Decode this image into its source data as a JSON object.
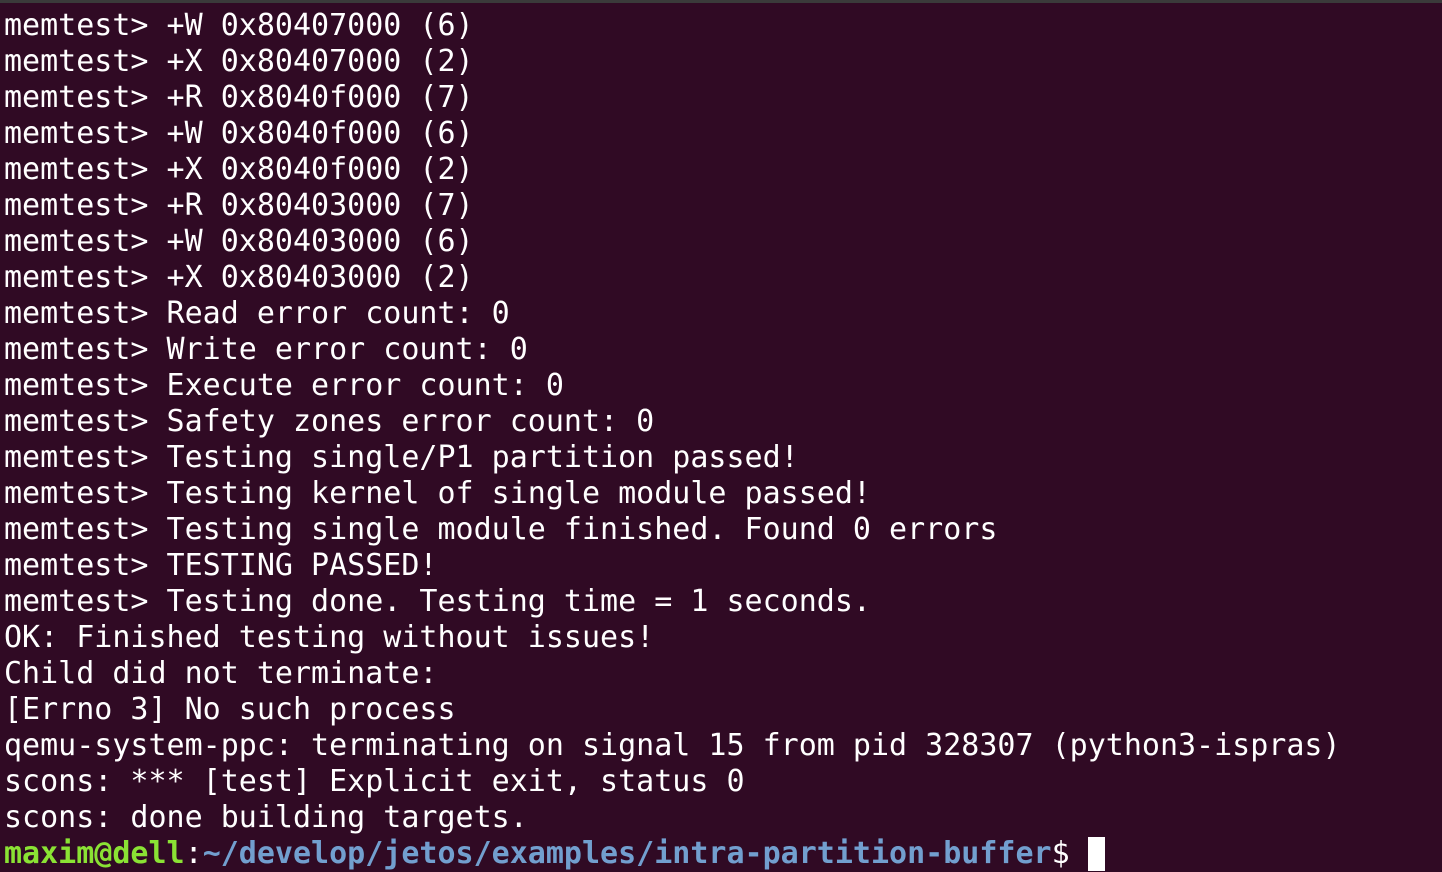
{
  "terminal": {
    "lines": [
      "memtest> +W 0x80407000 (6)",
      "memtest> +X 0x80407000 (2)",
      "memtest> +R 0x8040f000 (7)",
      "memtest> +W 0x8040f000 (6)",
      "memtest> +X 0x8040f000 (2)",
      "memtest> +R 0x80403000 (7)",
      "memtest> +W 0x80403000 (6)",
      "memtest> +X 0x80403000 (2)",
      "memtest> Read error count: 0",
      "memtest> Write error count: 0",
      "memtest> Execute error count: 0",
      "memtest> Safety zones error count: 0",
      "memtest> Testing single/P1 partition passed!",
      "memtest> Testing kernel of single module passed!",
      "memtest> Testing single module finished. Found 0 errors",
      "memtest> TESTING PASSED!",
      "memtest> Testing done. Testing time = 1 seconds.",
      "OK: Finished testing without issues!",
      "Child did not terminate:",
      "[Errno 3] No such process",
      "qemu-system-ppc: terminating on signal 15 from pid 328307 (python3-ispras)",
      "scons: *** [test] Explicit exit, status 0",
      "scons: done building targets."
    ],
    "prompt": {
      "user_host": "maxim@dell",
      "separator": ":",
      "path": "~/develop/jetos/examples/intra-partition-buffer",
      "symbol": "$"
    },
    "colors": {
      "background": "#300a24",
      "text": "#ffffff",
      "user_host": "#8ae234",
      "path": "#729fcf"
    }
  }
}
